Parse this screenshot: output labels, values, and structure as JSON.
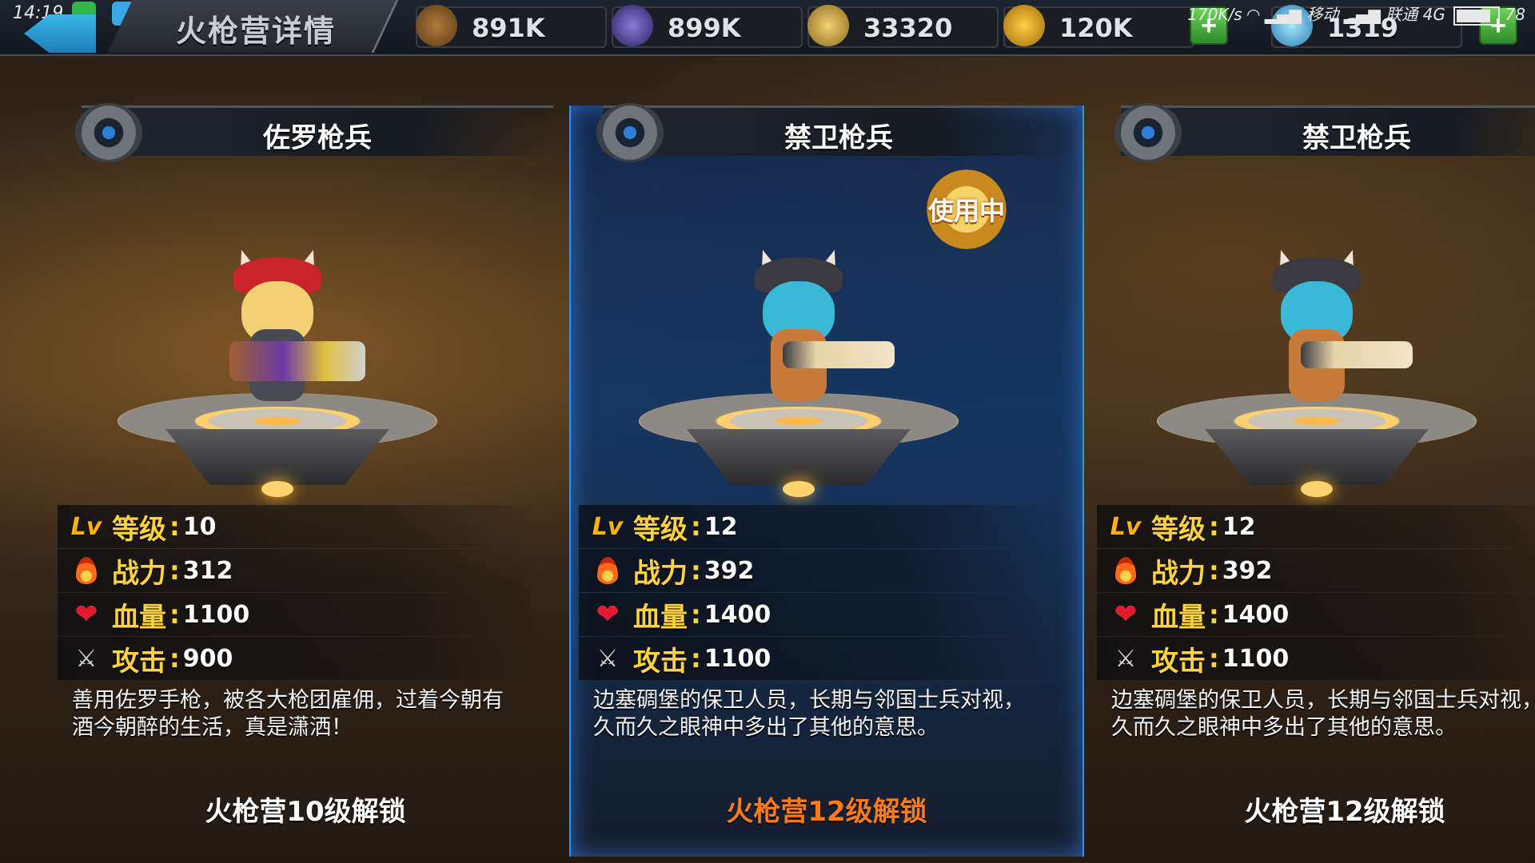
{
  "status_bar": {
    "time": "14:19",
    "net_speed": "170K/s",
    "carrier1": "移动",
    "carrier2": "联通 4G",
    "battery": "78"
  },
  "header": {
    "title": "火枪营详情",
    "resources": [
      {
        "name": "wood-icon",
        "value": "891K",
        "color": "#8a5a2a"
      },
      {
        "name": "crystal-icon",
        "value": "899K",
        "color": "#5a4aa8"
      },
      {
        "name": "food-icon",
        "value": "33320",
        "color": "#c8a040"
      },
      {
        "name": "gold-icon",
        "value": "120K",
        "color": "#d8a020"
      },
      {
        "name": "diamond-icon",
        "value": "1319",
        "color": "#5ab8e8"
      }
    ],
    "add_label": "+"
  },
  "cards": [
    {
      "name": "佐罗枪兵",
      "active": false,
      "stats": {
        "lv_icon": "Lv",
        "level_label": "等级",
        "level": "10",
        "power_label": "战力",
        "power": "312",
        "hp_label": "血量",
        "hp": "1100",
        "atk_label": "攻击",
        "atk": "900"
      },
      "colon": ":",
      "description": "善用佐罗手枪，被各大枪团雇佣，过着今朝有酒今朝醉的生活，真是潇洒！",
      "unlock": "火枪营10级解锁",
      "hat_color": "#c8242a",
      "hair_color": "#f0d070",
      "gun_color": "#6a3aa8"
    },
    {
      "name": "禁卫枪兵",
      "active": true,
      "badge": "使用中",
      "stats": {
        "lv_icon": "Lv",
        "level_label": "等级",
        "level": "12",
        "power_label": "战力",
        "power": "392",
        "hp_label": "血量",
        "hp": "1400",
        "atk_label": "攻击",
        "atk": "1100"
      },
      "colon": ":",
      "description": "边塞碉堡的保卫人员，长期与邻国士兵对视，久而久之眼神中多出了其他的意思。",
      "unlock": "火枪营12级解锁",
      "hat_color": "#3a3a40",
      "hair_color": "#3ab8d8",
      "gun_color": "#e8d4a8"
    },
    {
      "name": "禁卫枪兵",
      "active": false,
      "stats": {
        "lv_icon": "Lv",
        "level_label": "等级",
        "level": "12",
        "power_label": "战力",
        "power": "392",
        "hp_label": "血量",
        "hp": "1400",
        "atk_label": "攻击",
        "atk": "1100"
      },
      "colon": ":",
      "description": "边塞碉堡的保卫人员，长期与邻国士兵对视，久而久之眼神中多出了其他的意思。",
      "unlock": "火枪营12级解锁",
      "hat_color": "#3a3a40",
      "hair_color": "#3ab8d8",
      "gun_color": "#e8d4a8"
    }
  ],
  "colors": {
    "accent_yellow": "#ffd23f",
    "unlock_highlight": "#ff7a1a",
    "active_border": "#3a8fe8"
  }
}
